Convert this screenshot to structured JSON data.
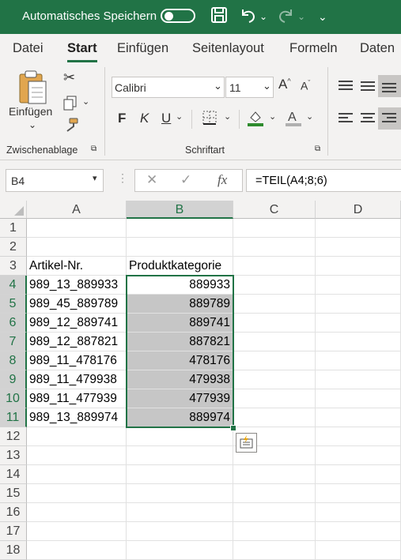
{
  "titlebar": {
    "autosave_label": "Automatisches Speichern"
  },
  "tabs": [
    "Datei",
    "Start",
    "Einfügen",
    "Seitenlayout",
    "Formeln",
    "Daten"
  ],
  "ribbon": {
    "paste_label": "Einfügen",
    "clipboard_group": "Zwischenablage",
    "font_name": "Calibri",
    "font_size": "11",
    "font_group": "Schriftart",
    "bold": "F",
    "italic": "K",
    "underline": "U"
  },
  "formula_bar": {
    "name_box": "B4",
    "formula": "=TEIL(A4;8;6)",
    "fx": "fx"
  },
  "grid": {
    "columns": [
      "A",
      "B",
      "C",
      "D"
    ],
    "rows": [
      "1",
      "2",
      "3",
      "4",
      "5",
      "6",
      "7",
      "8",
      "9",
      "10",
      "11",
      "12",
      "13",
      "14",
      "15",
      "16",
      "17",
      "18"
    ],
    "header_a": "Artikel-Nr.",
    "header_b": "Produktkategorie",
    "data": [
      {
        "a": "989_13_889933",
        "b": "889933"
      },
      {
        "a": "989_45_889789",
        "b": "889789"
      },
      {
        "a": "989_12_889741",
        "b": "889741"
      },
      {
        "a": "989_12_887821",
        "b": "887821"
      },
      {
        "a": "989_11_478176",
        "b": "478176"
      },
      {
        "a": "989_11_479938",
        "b": "479938"
      },
      {
        "a": "989_11_477939",
        "b": "477939"
      },
      {
        "a": "989_13_889974",
        "b": "889974"
      }
    ]
  },
  "colors": {
    "accent": "#217346",
    "selection_fill": "#c6c6c6"
  }
}
